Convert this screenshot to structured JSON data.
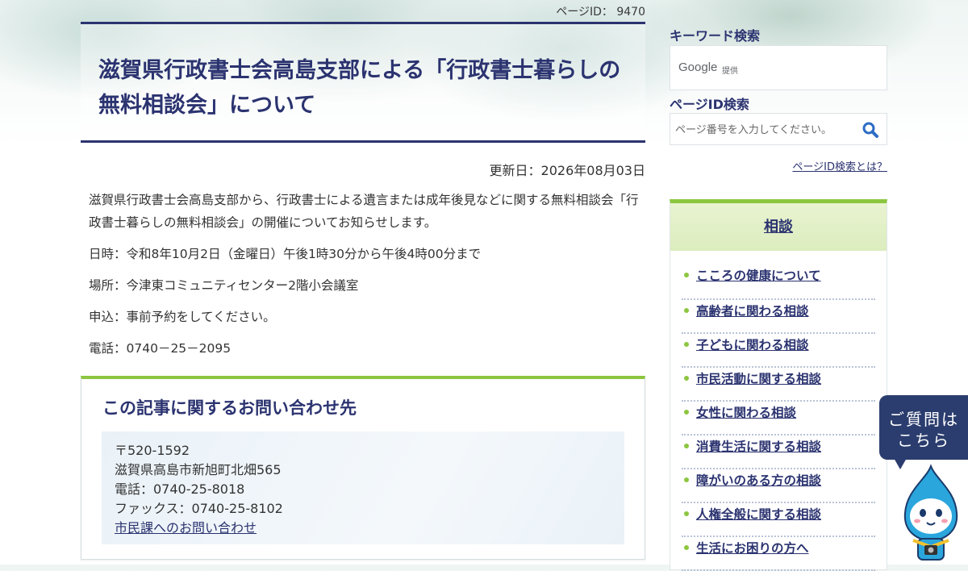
{
  "header": {
    "page_id_label": "ページID：",
    "page_id_value": "9470"
  },
  "article": {
    "title": "滋賀県行政書士会高島支部による「行政書士暮らしの無料相談会」について",
    "updated": "更新日：2026年08月03日",
    "paragraphs": [
      "滋賀県行政書士会高島支部から、行政書士による遺言または成年後見などに関する無料相談会「行政書士暮らしの無料相談会」の開催についてお知らせします。",
      "日時：令和8年10月2日（金曜日）午後1時30分から午後4時00分まで",
      "場所：今津東コミュニティセンター2階小会議室",
      "申込：事前予約をしてください。",
      "電話：0740－25－2095"
    ]
  },
  "contact": {
    "heading": "この記事に関するお問い合わせ先",
    "postal": "〒520-1592",
    "address": "滋賀県高島市新旭町北畑565",
    "phone": "電話：0740-25-8018",
    "fax": "ファックス：0740-25-8102",
    "link": "市民課へのお問い合わせ"
  },
  "sidebar": {
    "keyword_label": "キーワード検索",
    "google_logo": "Google",
    "google_sub": "提供",
    "pageid_label": "ページID検索",
    "pageid_placeholder": "ページ番号を入力してください。",
    "pageid_help": "ページID検索とは？",
    "category_title": "相談",
    "categories": [
      "こころの健康について",
      "高齢者に関わる相談",
      "子どもに関わる相談",
      "市民活動に関する相談",
      "女性に関わる相談",
      "消費生活に関する相談",
      "障がいのある方の相談",
      "人権全般に関する相談",
      "生活にお困りの方へ"
    ]
  },
  "chat": {
    "line1": "ご質問は",
    "line2": "こちら"
  },
  "colors": {
    "navy": "#2b3370",
    "green": "#8cc63f",
    "chat": "#2b3d6e"
  },
  "icons": {
    "search": "search-icon",
    "mascot": "mascot-icon"
  }
}
